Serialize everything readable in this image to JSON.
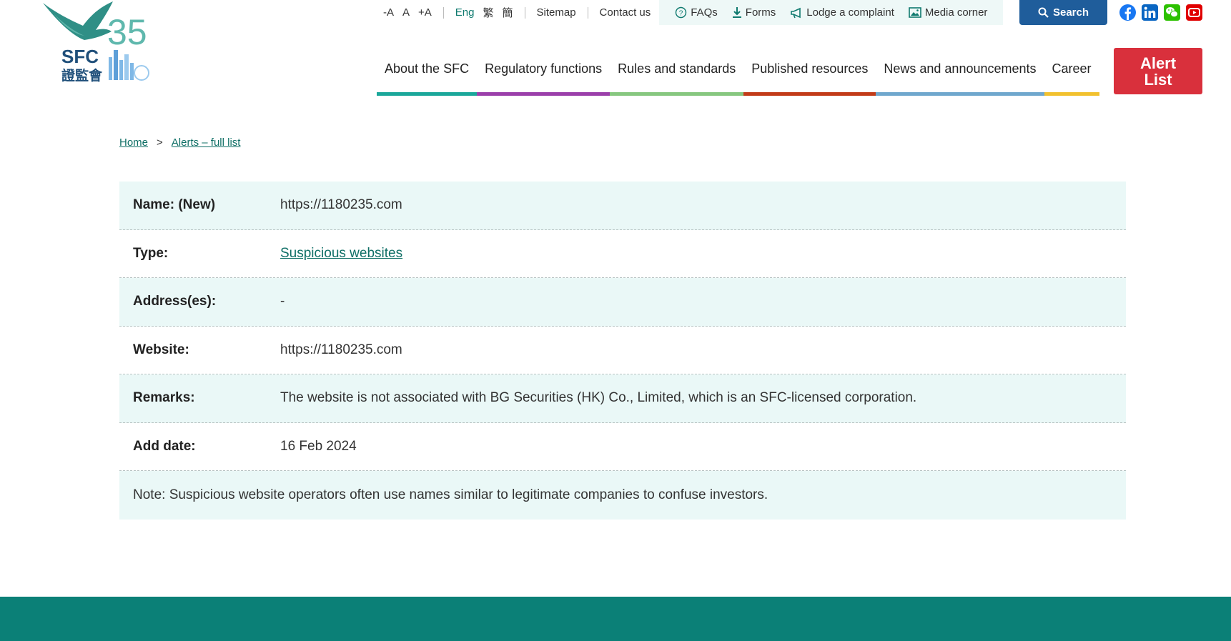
{
  "header": {
    "logo": {
      "letters": "SFC",
      "anniversary": "35",
      "chinese": "證監會"
    },
    "utility": {
      "font_smaller": "-A",
      "font_normal": "A",
      "font_larger": "+A",
      "lang_en": "Eng",
      "lang_tc": "繁",
      "lang_sc": "簡",
      "sitemap": "Sitemap",
      "contact": "Contact us"
    },
    "quick_links": {
      "faqs": "FAQs",
      "forms": "Forms",
      "complaint": "Lodge a complaint",
      "media": "Media corner"
    },
    "search_label": "Search",
    "alert_label_1": "Alert",
    "alert_label_2": "List",
    "nav": [
      {
        "label": "About the SFC",
        "color": "#1aa79a"
      },
      {
        "label": "Regulatory functions",
        "color": "#9b3faa"
      },
      {
        "label": "Rules and standards",
        "color": "#86c77f"
      },
      {
        "label": "Published resources",
        "color": "#c23b18"
      },
      {
        "label": "News and announcements",
        "color": "#6fa7cd"
      },
      {
        "label": "Career",
        "color": "#f2c12e"
      }
    ],
    "social_colors": {
      "facebook": "#1877f2",
      "linkedin": "#0a66c2",
      "wechat": "#2dc100",
      "youtube": "#e00000"
    }
  },
  "breadcrumb": {
    "home": "Home",
    "separator": ">",
    "current": "Alerts – full list"
  },
  "details": {
    "name_label": "Name: (New)",
    "name_value": "https://1180235.com",
    "type_label": "Type:",
    "type_value": "Suspicious websites",
    "address_label": "Address(es):",
    "address_value": "-",
    "website_label": "Website:",
    "website_value": "https://1180235.com",
    "remarks_label": "Remarks:",
    "remarks_value": "The website is not associated with BG Securities (HK) Co., Limited, which is an SFC-licensed corporation.",
    "date_label": "Add date:",
    "date_value": "16 Feb 2024",
    "note": "Note: Suspicious website operators often use names similar to legitimate companies to confuse investors."
  },
  "colors": {
    "brand_teal": "#0b8077",
    "link_green": "#0f6f66",
    "search_blue": "#1f5d9b",
    "alert_red": "#d9303c",
    "row_shade": "#eaf8f7"
  }
}
